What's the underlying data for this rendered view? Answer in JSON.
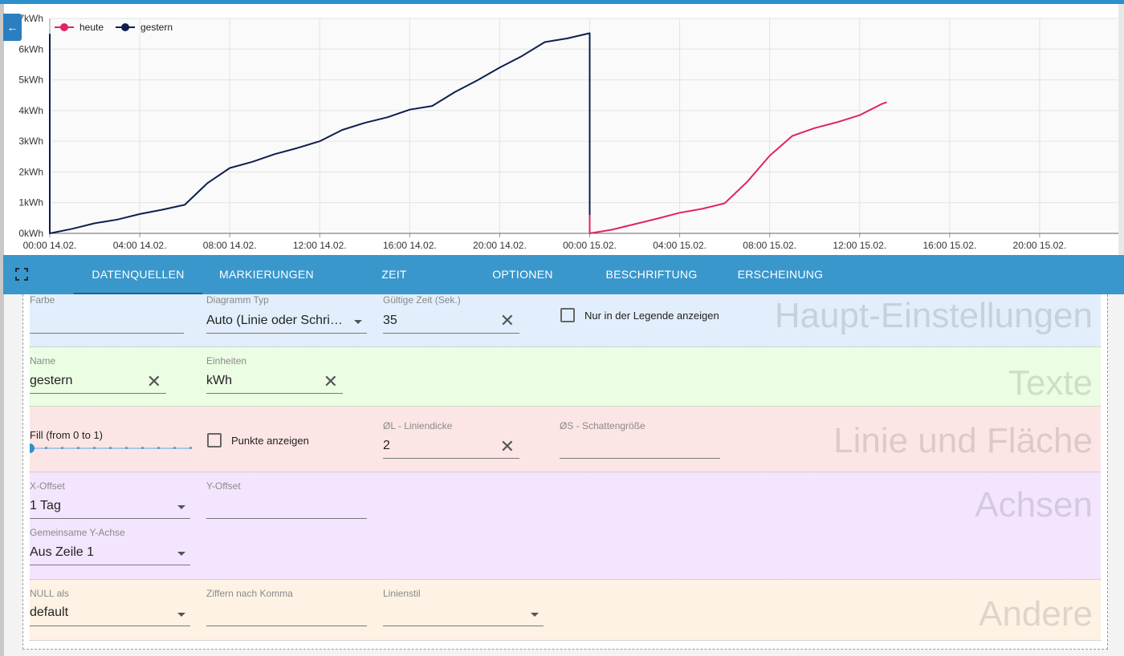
{
  "chart": {
    "y_ticks": [
      "0kWh",
      "1kWh",
      "2kWh",
      "3kWh",
      "4kWh",
      "5kWh",
      "6kWh",
      "7kWh"
    ],
    "x_ticks": [
      "00:00 14.02.",
      "04:00 14.02.",
      "08:00 14.02.",
      "12:00 14.02.",
      "16:00 14.02.",
      "20:00 14.02.",
      "00:00 15.02.",
      "04:00 15.02.",
      "08:00 15.02.",
      "12:00 15.02.",
      "16:00 15.02.",
      "20:00 15.02."
    ],
    "legend": [
      {
        "name": "heute",
        "color": "#e0245e"
      },
      {
        "name": "gestern",
        "color": "#0d1f4f"
      }
    ]
  },
  "chart_data": {
    "type": "line",
    "xlabel": "",
    "ylabel": "",
    "ylim": [
      0,
      7
    ],
    "xlim_hours": [
      0,
      47.5
    ],
    "unit": "kWh",
    "series": [
      {
        "name": "gestern",
        "color": "#0d1f4f",
        "x_hours": [
          0,
          0,
          1,
          2,
          3,
          4,
          5,
          6,
          7,
          8,
          9,
          10,
          11,
          12,
          13,
          14,
          15,
          16,
          17,
          18,
          19,
          20,
          21,
          22,
          23,
          24,
          24
        ],
        "values": [
          6.5,
          0.0,
          0.15,
          0.33,
          0.45,
          0.63,
          0.77,
          0.93,
          1.63,
          2.13,
          2.33,
          2.58,
          2.78,
          3.0,
          3.37,
          3.6,
          3.78,
          4.03,
          4.15,
          4.6,
          4.98,
          5.4,
          5.78,
          6.23,
          6.35,
          6.52,
          0.5
        ]
      },
      {
        "name": "heute",
        "color": "#e0245e",
        "x_hours": [
          24,
          24,
          25,
          26,
          27,
          28,
          29,
          30,
          31,
          32,
          33,
          34,
          35,
          36,
          37,
          37.2
        ],
        "values": [
          0.6,
          0.0,
          0.12,
          0.3,
          0.48,
          0.67,
          0.8,
          0.98,
          1.68,
          2.53,
          3.17,
          3.43,
          3.62,
          3.85,
          4.22,
          4.27
        ]
      }
    ]
  },
  "tabs": [
    {
      "label": "DATENQUELLEN",
      "active": true
    },
    {
      "label": "MARKIERUNGEN",
      "active": false
    },
    {
      "label": "ZEIT",
      "active": false
    },
    {
      "label": "OPTIONEN",
      "active": false
    },
    {
      "label": "BESCHRIFTUNG",
      "active": false
    },
    {
      "label": "ERSCHEINUNG",
      "active": false
    }
  ],
  "sections": {
    "main": {
      "title": "Haupt-Einstellungen",
      "color_label": "Farbe",
      "color_value": "",
      "chart_type_label": "Diagramm Typ",
      "chart_type_value": "Auto (Linie oder Schri…",
      "valid_time_label": "Gültige Zeit (Sek.)",
      "valid_time_value": "35",
      "legend_only_label": "Nur in der Legende anzeigen",
      "legend_only_checked": false,
      "bg": "#e2eefb"
    },
    "texts": {
      "title": "Texte",
      "name_label": "Name",
      "name_value": "gestern",
      "units_label": "Einheiten",
      "units_value": "kWh",
      "bg": "#ebfde3"
    },
    "line": {
      "title": "Linie und Fläche",
      "fill_label": "Fill (from 0 to 1)",
      "fill_value": 0,
      "points_label": "Punkte anzeigen",
      "points_checked": false,
      "line_width_label": "ØL - Liniendicke",
      "line_width_value": "2",
      "shadow_label": "ØS - Schattengröße",
      "shadow_value": "",
      "bg": "#fce5e5"
    },
    "axes": {
      "title": "Achsen",
      "x_offset_label": "X-Offset",
      "x_offset_value": "1 Tag",
      "y_offset_label": "Y-Offset",
      "y_offset_value": "",
      "shared_y_label": "Gemeinsame Y-Achse",
      "shared_y_value": "Aus Zeile 1",
      "bg": "#f3e5fd"
    },
    "other": {
      "title": "Andere",
      "null_label": "NULL als",
      "null_value": "default",
      "decimals_label": "Ziffern nach Komma",
      "decimals_value": "",
      "line_style_label": "Linienstil",
      "line_style_value": "",
      "bg": "#fdf2e4"
    }
  }
}
